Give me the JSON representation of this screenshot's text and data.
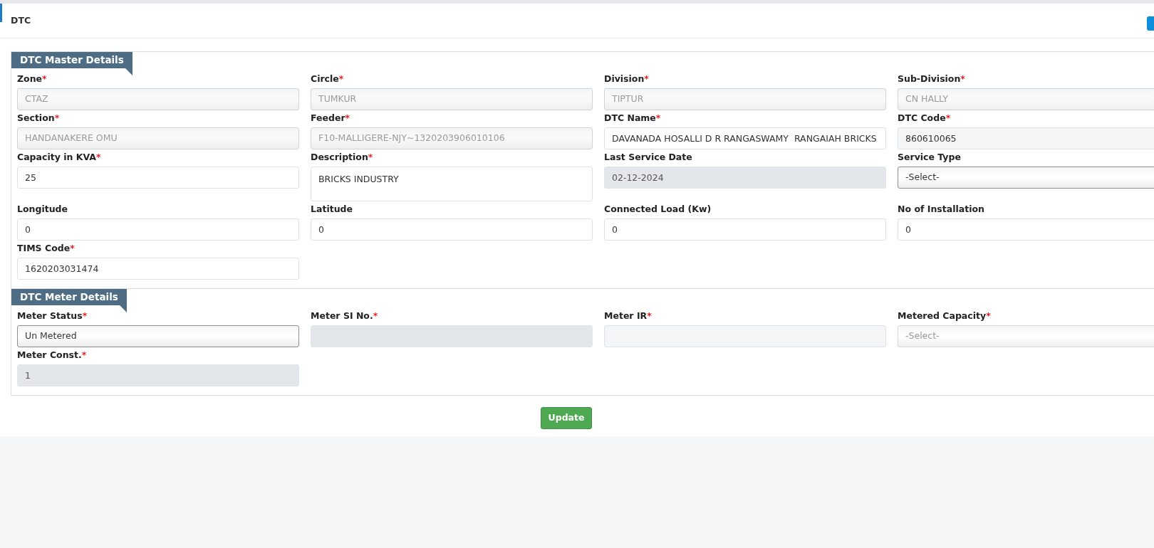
{
  "page": {
    "title": "DTC"
  },
  "sections": [
    {
      "legend": "DTC Master Details",
      "fields": [
        {
          "label": "Zone",
          "required_mark": "*",
          "kind": "readonly",
          "value": "CTAZ"
        },
        {
          "label": "Circle",
          "required_mark": "*",
          "kind": "readonly",
          "value": "TUMKUR"
        },
        {
          "label": "Division",
          "required_mark": "*",
          "kind": "readonly",
          "value": "TIPTUR"
        },
        {
          "label": "Sub-Division",
          "required_mark": "*",
          "kind": "readonly",
          "value": "CN HALLY"
        },
        {
          "label": "Section",
          "required_mark": "*",
          "kind": "readonly",
          "value": "HANDANAKERE OMU"
        },
        {
          "label": "Feeder",
          "required_mark": "*",
          "kind": "readonly",
          "value": "F10-MALLIGERE-NJY~1320203906010106"
        },
        {
          "label": "DTC Name",
          "required_mark": "*",
          "kind": "input",
          "value": "DAVANADA HOSALLI D R RANGASWAMY  RANGAIAH BRICKS"
        },
        {
          "label": "DTC Code",
          "required_mark": "*",
          "kind": "lightgrey",
          "value": "860610065"
        },
        {
          "label": "Capacity in KVA",
          "required_mark": "*",
          "kind": "input",
          "value": "25"
        },
        {
          "label": "Description",
          "required_mark": "*",
          "kind": "textarea",
          "value": "BRICKS INDUSTRY"
        },
        {
          "label": "Last Service Date",
          "kind": "disabled",
          "value": "02-12-2024"
        },
        {
          "label": "Service Type",
          "kind": "select",
          "disabled": false,
          "value": "-Select-"
        },
        {
          "label": "Longitude",
          "kind": "input",
          "value": "0"
        },
        {
          "label": "Latitude",
          "kind": "input",
          "value": "0"
        },
        {
          "label": "Connected Load (Kw)",
          "kind": "input",
          "value": "0"
        },
        {
          "label": "No of Installation",
          "kind": "input",
          "value": "0"
        },
        {
          "label": "TIMS Code",
          "required_mark": "*",
          "kind": "input",
          "value": "1620203031474"
        }
      ]
    },
    {
      "legend": "DTC Meter Details",
      "fields": [
        {
          "label": "Meter Status",
          "required_mark": "*",
          "kind": "select",
          "disabled": false,
          "value": "Un Metered"
        },
        {
          "label": "Meter SI No.",
          "required_mark": "*",
          "kind": "disabled"
        },
        {
          "label": "Meter IR",
          "required_mark": "*",
          "kind": "lightgrey"
        },
        {
          "label": "Metered Capacity",
          "required_mark": "*",
          "kind": "select",
          "disabled": true,
          "value": "-Select-"
        },
        {
          "label": "Meter Const.",
          "required_mark": "*",
          "kind": "disabled",
          "value": "1"
        }
      ]
    }
  ],
  "update_button": "Update"
}
